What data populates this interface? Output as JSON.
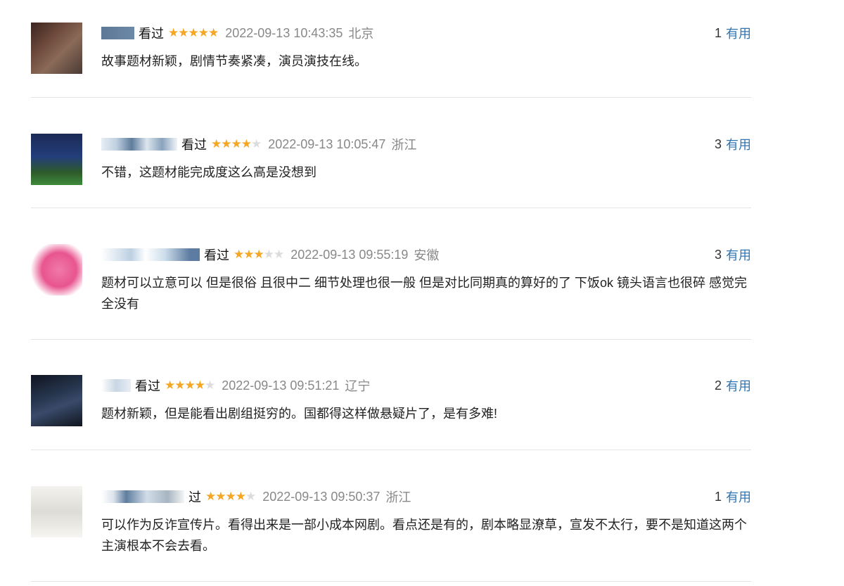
{
  "reviews": [
    {
      "verb": "看过",
      "rating": 5,
      "time": "2022-09-13 10:43:35",
      "location": "北京",
      "useful_count": "1",
      "useful_label": "有用",
      "content": "故事题材新颖，剧情节奏紧凑，演员演技在线。"
    },
    {
      "verb": "看过",
      "rating": 4,
      "time": "2022-09-13 10:05:47",
      "location": "浙江",
      "useful_count": "3",
      "useful_label": "有用",
      "content": "不错，这题材能完成度这么高是没想到"
    },
    {
      "verb": "看过",
      "rating": 3,
      "time": "2022-09-13 09:55:19",
      "location": "安徽",
      "useful_count": "3",
      "useful_label": "有用",
      "content": "题材可以立意可以 但是很俗 且很中二 细节处理也很一般 但是对比同期真的算好的了 下饭ok 镜头语言也很碎 感觉完全没有"
    },
    {
      "verb": "看过",
      "rating": 4,
      "time": "2022-09-13 09:51:21",
      "location": "辽宁",
      "useful_count": "2",
      "useful_label": "有用",
      "content": "题材新颖，但是能看出剧组挺穷的。国都得这样做悬疑片了，是有多难!"
    },
    {
      "verb": "过",
      "rating": 4,
      "time": "2022-09-13 09:50:37",
      "location": "浙江",
      "useful_count": "1",
      "useful_label": "有用",
      "content": "可以作为反诈宣传片。看得出来是一部小成本网剧。看点还是有的，剧本略显潦草，宣发不太行，要不是知道这两个主演根本不会去看。"
    }
  ],
  "icons": {
    "star_filled": "★",
    "star_empty": "★"
  },
  "colors": {
    "star_on": "#f5a623",
    "star_off": "#dcdcdc",
    "link": "#2f75b5",
    "meta": "#888888",
    "divider": "#e5e5e5"
  }
}
